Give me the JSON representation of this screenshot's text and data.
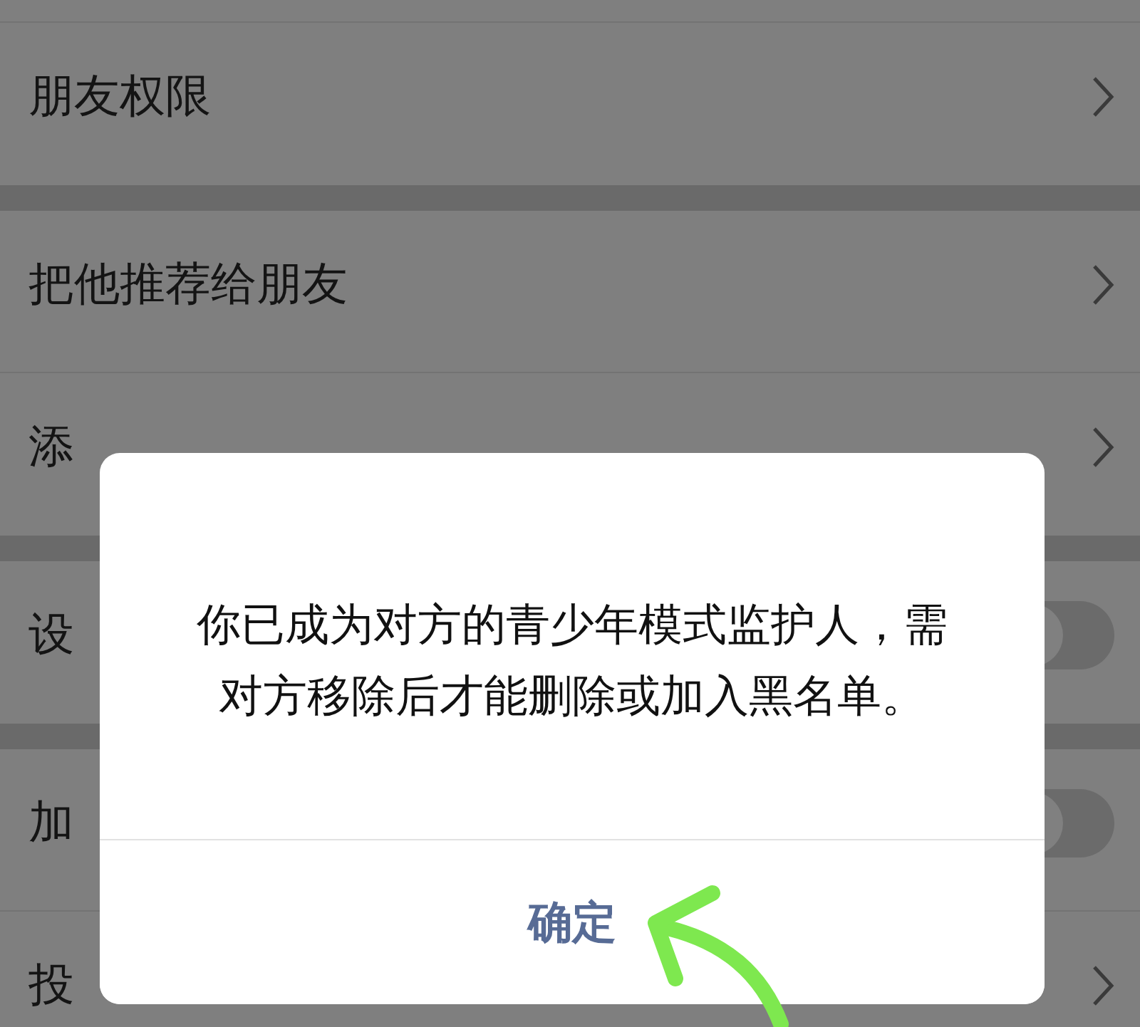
{
  "settings_rows": [
    {
      "label": "朋友权限",
      "kind": "link",
      "group_end": true
    },
    {
      "label": "把他推荐给朋友",
      "kind": "link",
      "group_end": false
    },
    {
      "label": "添",
      "kind": "link",
      "group_end": true
    },
    {
      "label": "设",
      "kind": "switch",
      "on": false,
      "group_end": true
    },
    {
      "label": "加",
      "kind": "switch",
      "on": false,
      "group_end": false
    },
    {
      "label": "投",
      "kind": "link",
      "group_end": false
    }
  ],
  "dialog": {
    "message": "你已成为对方的青少年模式监护人，需对方移除后才能删除或加入黑名单。",
    "confirm": "确定"
  }
}
